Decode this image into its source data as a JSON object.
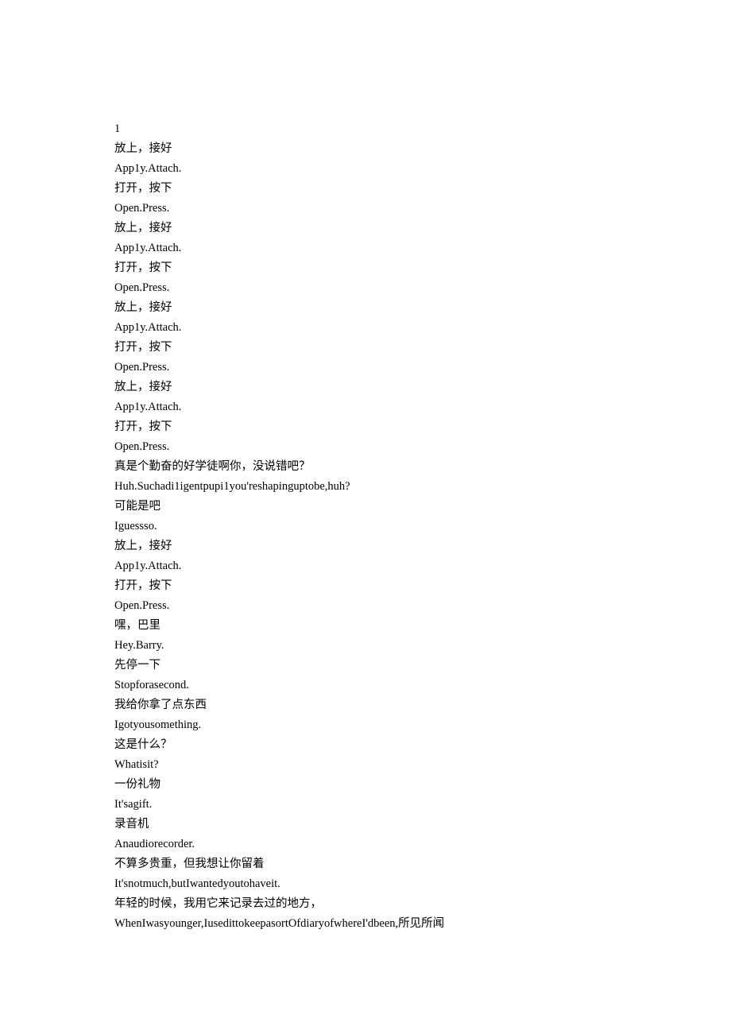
{
  "lines": [
    "1",
    "放上，接好",
    "App1y.Attach.",
    "打开，按下",
    "Open.Press.",
    "放上，接好",
    "App1y.Attach.",
    "打开，按下",
    "Open.Press.",
    "放上，接好",
    "App1y.Attach.",
    "打开，按下",
    "Open.Press.",
    "放上，接好",
    "App1y.Attach.",
    "打开，按下",
    "Open.Press.",
    "真是个勤奋的好学徒啊你，没说错吧？",
    "Huh.Suchadi1igentpupi1you'reshapinguptobe,huh?",
    "可能是吧",
    "Iguessso.",
    "放上，接好",
    "App1y.Attach.",
    "打开，按下",
    "Open.Press.",
    "嘿，巴里",
    "Hey.Barry.",
    "先停一下",
    "Stopforasecond.",
    "我给你拿了点东西",
    "Igotyousomething.",
    "这是什么？",
    "Whatisit?",
    "一份礼物",
    "It'sagift.",
    "录音机",
    "Anaudiorecorder.",
    "不算多贵重，但我想让你留着",
    "It'snotmuch,butIwantedyoutohaveit.",
    "年轻的时候，我用它来记录去过的地方，",
    "WhenIwasyounger,IusedittokeepasortOfdiaryofwhereI'dbeen,所见所闻"
  ]
}
